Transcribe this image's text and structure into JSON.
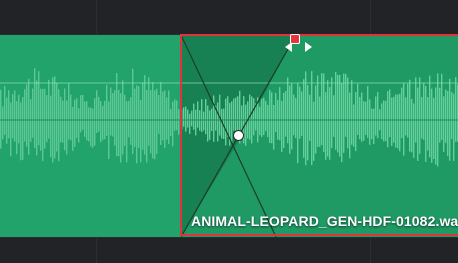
{
  "timeline": {
    "clips": [
      {
        "id": "clip-a",
        "color": "#22a36c"
      },
      {
        "id": "clip-b",
        "name": "ANIMAL-LEOPARD_GEN-HDF-01082.wa",
        "color": "#1f9a65",
        "selected": true,
        "selection_color": "#e0343a"
      }
    ],
    "fade": {
      "handle_icon": "fade-handle-icon",
      "handle_color": "#e8343b",
      "resize_icon": "horizontal-resize-arrows-icon",
      "crossfade_point_icon": "crossfade-point-icon"
    },
    "background_color": "#222327",
    "waveform_color": "#6fd3a3"
  }
}
